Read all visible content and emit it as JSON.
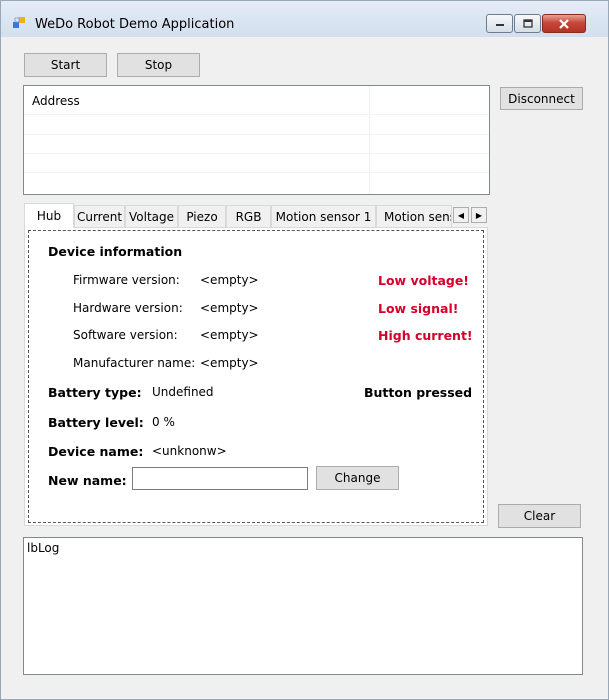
{
  "window": {
    "title": "WeDo Robot Demo Application"
  },
  "toolbar": {
    "start_label": "Start",
    "stop_label": "Stop"
  },
  "device_list": {
    "column_header": "Address"
  },
  "side_buttons": {
    "disconnect_label": "Disconnect",
    "clear_label": "Clear"
  },
  "tabs": [
    {
      "label": "Hub"
    },
    {
      "label": "Current"
    },
    {
      "label": "Voltage"
    },
    {
      "label": "Piezo"
    },
    {
      "label": "RGB"
    },
    {
      "label": "Motion sensor 1"
    },
    {
      "label": "Motion sensc"
    }
  ],
  "hub": {
    "section_title": "Device information",
    "firmware_label": "Firmware version:",
    "firmware_value": "<empty>",
    "hardware_label": "Hardware version:",
    "hardware_value": "<empty>",
    "software_label": "Software version:",
    "software_value": "<empty>",
    "manufacturer_label": "Manufacturer name:",
    "manufacturer_value": "<empty>",
    "warning_low_voltage": "Low voltage!",
    "warning_low_signal": "Low signal!",
    "warning_high_current": "High current!",
    "battery_type_label": "Battery type:",
    "battery_type_value": "Undefined",
    "button_pressed": "Button pressed",
    "battery_level_label": "Battery level:",
    "battery_level_value": "0 %",
    "device_name_label": "Device name:",
    "device_name_value": "<unknonw>",
    "new_name_label": "New name:",
    "new_name_value": "",
    "change_label": "Change"
  },
  "log": {
    "text": "lbLog"
  },
  "colors": {
    "warning": "#d4002c",
    "title_bar": "#dbe5f2",
    "close_button": "#c7483a"
  }
}
